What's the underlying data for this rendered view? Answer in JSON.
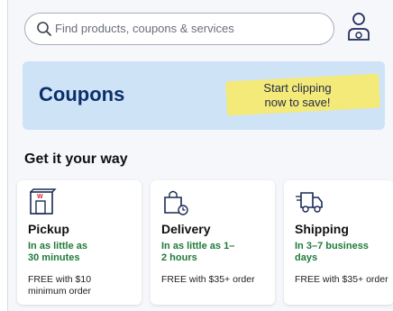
{
  "search": {
    "placeholder": "Find products, coupons & services",
    "icon": "search-icon"
  },
  "account": {
    "icon": "account-icon"
  },
  "banner": {
    "title": "Coupons",
    "cta_line1": "Start clipping",
    "cta_line2": "now to save!",
    "background": "#cfe3f7",
    "highlight_color": "#f4ea7a"
  },
  "section": {
    "title": "Get it your way"
  },
  "cards": [
    {
      "name": "Pickup",
      "eta_line1": "In as little as",
      "eta_line2": "30 minutes",
      "fee_line1": "FREE with $10",
      "fee_line2": "minimum order",
      "icon": "store-pickup-icon"
    },
    {
      "name": "Delivery",
      "eta_line1": "In as little as 1–",
      "eta_line2": "2 hours",
      "fee_line1": "FREE with $35+ order",
      "fee_line2": "",
      "icon": "delivery-bag-icon"
    },
    {
      "name": "Shipping",
      "eta_line1": "In 3–7 business",
      "eta_line2": "days",
      "fee_line1": "FREE with $35+ order",
      "fee_line2": "",
      "icon": "shipping-truck-icon"
    }
  ],
  "colors": {
    "accent_green": "#1f7a3a",
    "brand_navy": "#0b2e6b"
  }
}
